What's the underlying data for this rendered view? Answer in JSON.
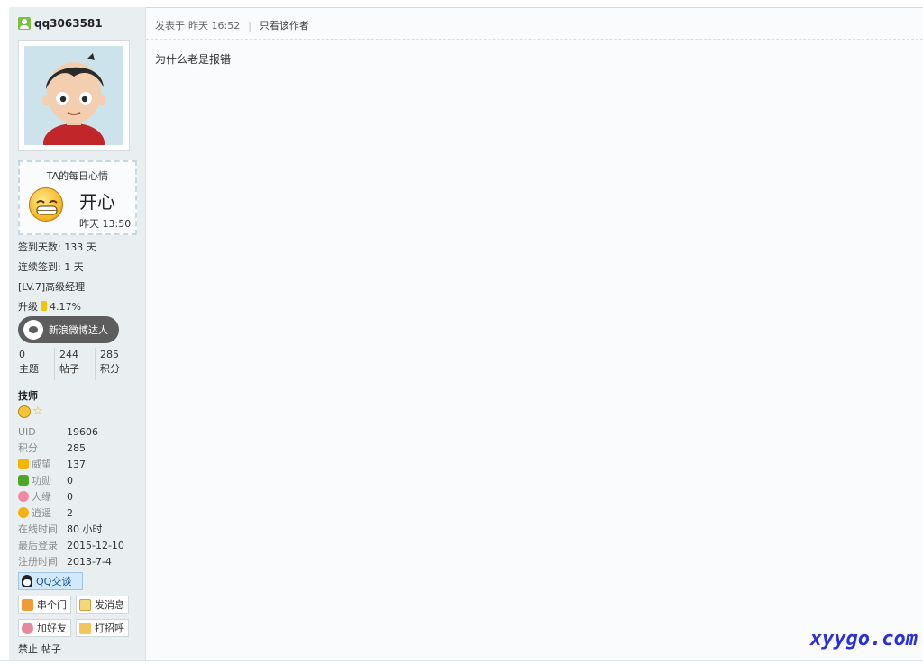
{
  "user": {
    "name": "qq3063581",
    "mood": {
      "title": "TA的每日心情",
      "value": "开心",
      "time": "昨天 13:50"
    },
    "checkin_days": "签到天数: 133 天",
    "streak": "连续签到: 1 天",
    "level": "[LV.7]高级经理",
    "upgrade_label": "升级",
    "upgrade_pct": "4.17%",
    "badge": "新浪微博达人",
    "stats": [
      {
        "value": "0",
        "label": "主题"
      },
      {
        "value": "244",
        "label": "帖子"
      },
      {
        "value": "285",
        "label": "积分"
      }
    ],
    "rank": "技师",
    "props": [
      {
        "key": "UID",
        "value": "19606",
        "icon": ""
      },
      {
        "key": "积分",
        "value": "285",
        "icon": ""
      },
      {
        "key": "威望",
        "value": "137",
        "icon": "crown-icon"
      },
      {
        "key": "功勋",
        "value": "0",
        "icon": "sprout-icon"
      },
      {
        "key": "人缘",
        "value": "0",
        "icon": "heart-icon"
      },
      {
        "key": "逍遥",
        "value": "2",
        "icon": "coin-icon"
      },
      {
        "key": "在线时间",
        "value": "80 小时",
        "icon": ""
      },
      {
        "key": "最后登录",
        "value": "2015-12-10",
        "icon": ""
      },
      {
        "key": "注册时间",
        "value": "2013-7-4",
        "icon": ""
      }
    ],
    "qq_button": "QQ交谈",
    "actions": {
      "visit": "串个门",
      "message": "发消息",
      "add_friend": "加好友",
      "greet": "打招呼"
    },
    "ban": "禁止",
    "posts": "帖子"
  },
  "post": {
    "meta_prefix": "发表于",
    "time": "昨天 16:52",
    "only_author": "只看该作者",
    "separator": "|",
    "content": "为什么老是报错"
  },
  "watermark": "xyygo.com",
  "colors": {
    "qq_button_bg": "#d1e9fb",
    "watermark": "#2a31d6",
    "badge_bg": "#5d5d5d"
  }
}
